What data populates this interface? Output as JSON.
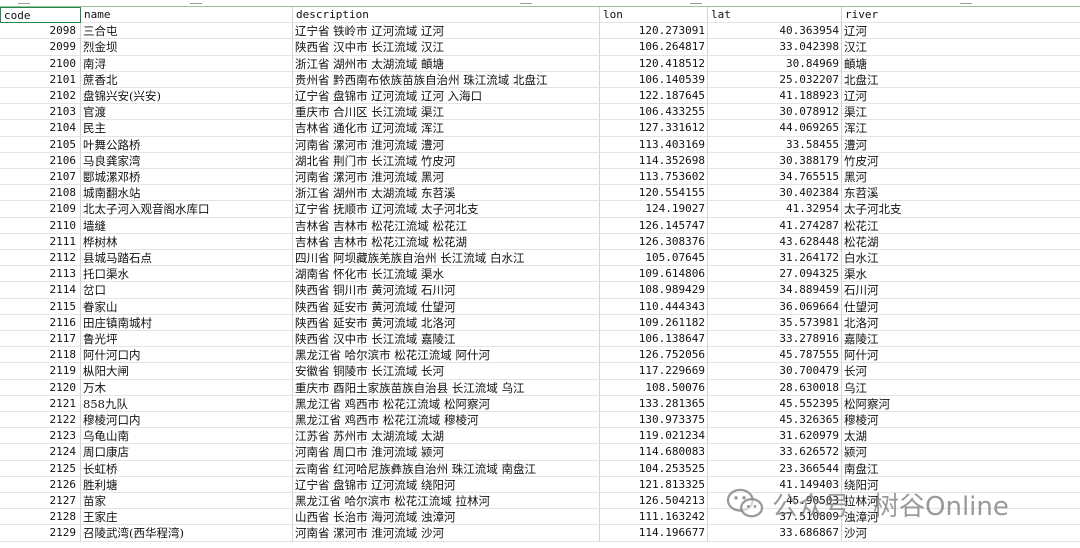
{
  "table": {
    "columns": [
      "code",
      "name",
      "description",
      "lon",
      "lat",
      "river"
    ],
    "rows": [
      [
        "2098",
        "三合屯",
        "辽宁省 铁岭市 辽河流域 辽河",
        "120.273091",
        "40.363954",
        "辽河"
      ],
      [
        "2099",
        "烈金坝",
        "陕西省 汉中市 长江流域 汉江",
        "106.264817",
        "33.042398",
        "汉江"
      ],
      [
        "2100",
        "南浔",
        "浙江省 湖州市 太湖流域 頔塘",
        "120.418512",
        "30.84969",
        "頔塘"
      ],
      [
        "2101",
        "蔗香北",
        "贵州省 黔西南布依族苗族自治州 珠江流域 北盘江",
        "106.140539",
        "25.032207",
        "北盘江"
      ],
      [
        "2102",
        "盘锦兴安(兴安)",
        "辽宁省 盘锦市 辽河流域 辽河 入海口",
        "122.187645",
        "41.188923",
        "辽河"
      ],
      [
        "2103",
        "官渡",
        "重庆市 合川区 长江流域 渠江",
        "106.433255",
        "30.078912",
        "渠江"
      ],
      [
        "2104",
        "民主",
        "吉林省 通化市 辽河流域 浑江",
        "127.331612",
        "44.069265",
        "浑江"
      ],
      [
        "2105",
        "叶舞公路桥",
        "河南省 漯河市 淮河流域 澧河",
        "113.403169",
        "33.58455",
        "澧河"
      ],
      [
        "2106",
        "马良龚家湾",
        "湖北省 荆门市 长江流域 竹皮河",
        "114.352698",
        "30.388179",
        "竹皮河"
      ],
      [
        "2107",
        "郾城漯邓桥",
        "河南省 漯河市 淮河流域 黑河",
        "113.753602",
        "34.765515",
        "黑河"
      ],
      [
        "2108",
        "城南翻水站",
        "浙江省 湖州市 太湖流域 东苕溪",
        "120.554155",
        "30.402384",
        "东苕溪"
      ],
      [
        "2109",
        "北太子河入观音阁水库口",
        "辽宁省 抚顺市 辽河流域 太子河北支",
        "124.19027",
        "41.32954",
        "太子河北支"
      ],
      [
        "2110",
        "墙缝",
        "吉林省 吉林市 松花江流域 松花江",
        "126.145747",
        "41.274287",
        "松花江"
      ],
      [
        "2111",
        "桦树林",
        "吉林省 吉林市 松花江流域 松花湖",
        "126.308376",
        "43.628448",
        "松花湖"
      ],
      [
        "2112",
        "县城马踏石点",
        "四川省 阿坝藏族羌族自治州 长江流域 白水江",
        "105.07645",
        "31.264172",
        "白水江"
      ],
      [
        "2113",
        "托口渠水",
        "湖南省 怀化市 长江流域 渠水",
        "109.614806",
        "27.094325",
        "渠水"
      ],
      [
        "2114",
        "岔口",
        "陕西省 铜川市 黄河流域 石川河",
        "108.989429",
        "34.889459",
        "石川河"
      ],
      [
        "2115",
        "眷家山",
        "陕西省 延安市 黄河流域 仕望河",
        "110.444343",
        "36.069664",
        "仕望河"
      ],
      [
        "2116",
        "田庄镇南城村",
        "陕西省 延安市 黄河流域 北洛河",
        "109.261182",
        "35.573981",
        "北洛河"
      ],
      [
        "2117",
        "鲁光坪",
        "陕西省 汉中市 长江流域 嘉陵江",
        "106.138647",
        "33.278916",
        "嘉陵江"
      ],
      [
        "2118",
        "阿什河口内",
        "黑龙江省 哈尔滨市 松花江流域 阿什河",
        "126.752056",
        "45.787555",
        "阿什河"
      ],
      [
        "2119",
        "枞阳大闸",
        "安徽省 铜陵市 长江流域 长河",
        "117.229669",
        "30.700479",
        "长河"
      ],
      [
        "2120",
        "万木",
        "重庆市 酉阳土家族苗族自治县 长江流域 乌江",
        "108.50076",
        "28.630018",
        "乌江"
      ],
      [
        "2121",
        "858九队",
        "黑龙江省 鸡西市 松花江流域 松阿察河",
        "133.281365",
        "45.552395",
        "松阿察河"
      ],
      [
        "2122",
        "穆棱河口内",
        "黑龙江省 鸡西市 松花江流域 穆棱河",
        "130.973375",
        "45.326365",
        "穆棱河"
      ],
      [
        "2123",
        "乌龟山南",
        "江苏省 苏州市 太湖流域 太湖",
        "119.021234",
        "31.620979",
        "太湖"
      ],
      [
        "2124",
        "周口康店",
        "河南省 周口市 淮河流域 颍河",
        "114.680083",
        "33.626572",
        "颍河"
      ],
      [
        "2125",
        "长虹桥",
        "云南省 红河哈尼族彝族自治州 珠江流域 南盘江",
        "104.253525",
        "23.366544",
        "南盘江"
      ],
      [
        "2126",
        "胜利塘",
        "辽宁省 盘锦市 辽河流域 绕阳河",
        "121.813325",
        "41.149403",
        "绕阳河"
      ],
      [
        "2127",
        "苗家",
        "黑龙江省 哈尔滨市 松花江流域 拉林河",
        "126.504213",
        "45.90503",
        "拉林河"
      ],
      [
        "2128",
        "王家庄",
        "山西省 长治市 海河流域 浊漳河",
        "111.163242",
        "37.510809",
        "浊漳河"
      ],
      [
        "2129",
        "召陵武湾(西华程湾)",
        "河南省 漯河市 淮河流域 沙河",
        "114.196677",
        "33.686867",
        "沙河"
      ]
    ]
  },
  "watermark": {
    "platform": "公众号",
    "separator": "·",
    "author": "树谷Online",
    "icon": "wechat-icon"
  },
  "colors": {
    "selection_border": "#1f8a4c",
    "grid_line": "#d4d4d4"
  }
}
